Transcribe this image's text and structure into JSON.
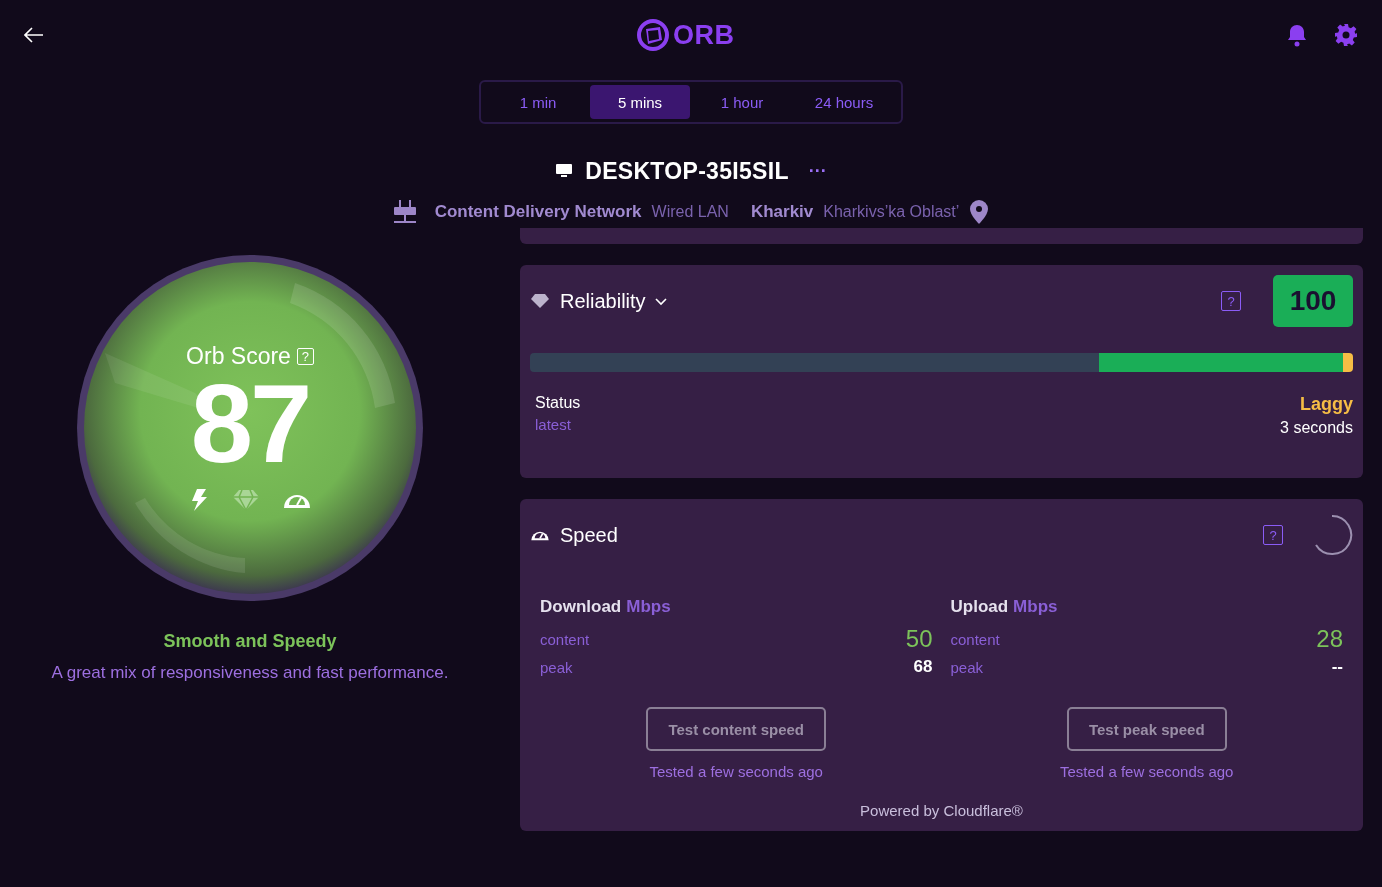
{
  "header": {
    "logo": "ORB"
  },
  "time_ranges": [
    {
      "label": "1 min",
      "selected": false
    },
    {
      "label": "5 mins",
      "selected": true
    },
    {
      "label": "1 hour",
      "selected": false
    },
    {
      "label": "24 hours",
      "selected": false
    }
  ],
  "device": {
    "name": "DESKTOP-35I5SIL",
    "more": "···",
    "network": "Content Delivery Network",
    "connection": "Wired LAN",
    "city": "Kharkiv",
    "region": "Kharkivs’ka Oblast’"
  },
  "orb_score": {
    "title": "Orb Score",
    "help": "?",
    "score": "87",
    "rating": "Smooth and Speedy",
    "description": "A great mix of responsiveness and fast performance."
  },
  "reliability": {
    "title": "Reliability",
    "help": "?",
    "score": "100",
    "status_label": "Status",
    "status_sub": "latest",
    "status_value": "Laggy",
    "status_time": "3 seconds"
  },
  "speed": {
    "title": "Speed",
    "help": "?",
    "columns": [
      {
        "heading": "Download",
        "unit": "Mbps",
        "rows": [
          {
            "label": "content",
            "value": "50",
            "kind": "highlight"
          },
          {
            "label": "peak",
            "value": "68",
            "kind": "plain"
          }
        ],
        "button": "Test content speed",
        "tested": "Tested a few seconds ago"
      },
      {
        "heading": "Upload",
        "unit": "Mbps",
        "rows": [
          {
            "label": "content",
            "value": "28",
            "kind": "highlight"
          },
          {
            "label": "peak",
            "value": "--",
            "kind": "plain"
          }
        ],
        "button": "Test peak speed",
        "tested": "Tested a few seconds ago"
      }
    ],
    "powered_by": "Powered by Cloudflare®"
  }
}
